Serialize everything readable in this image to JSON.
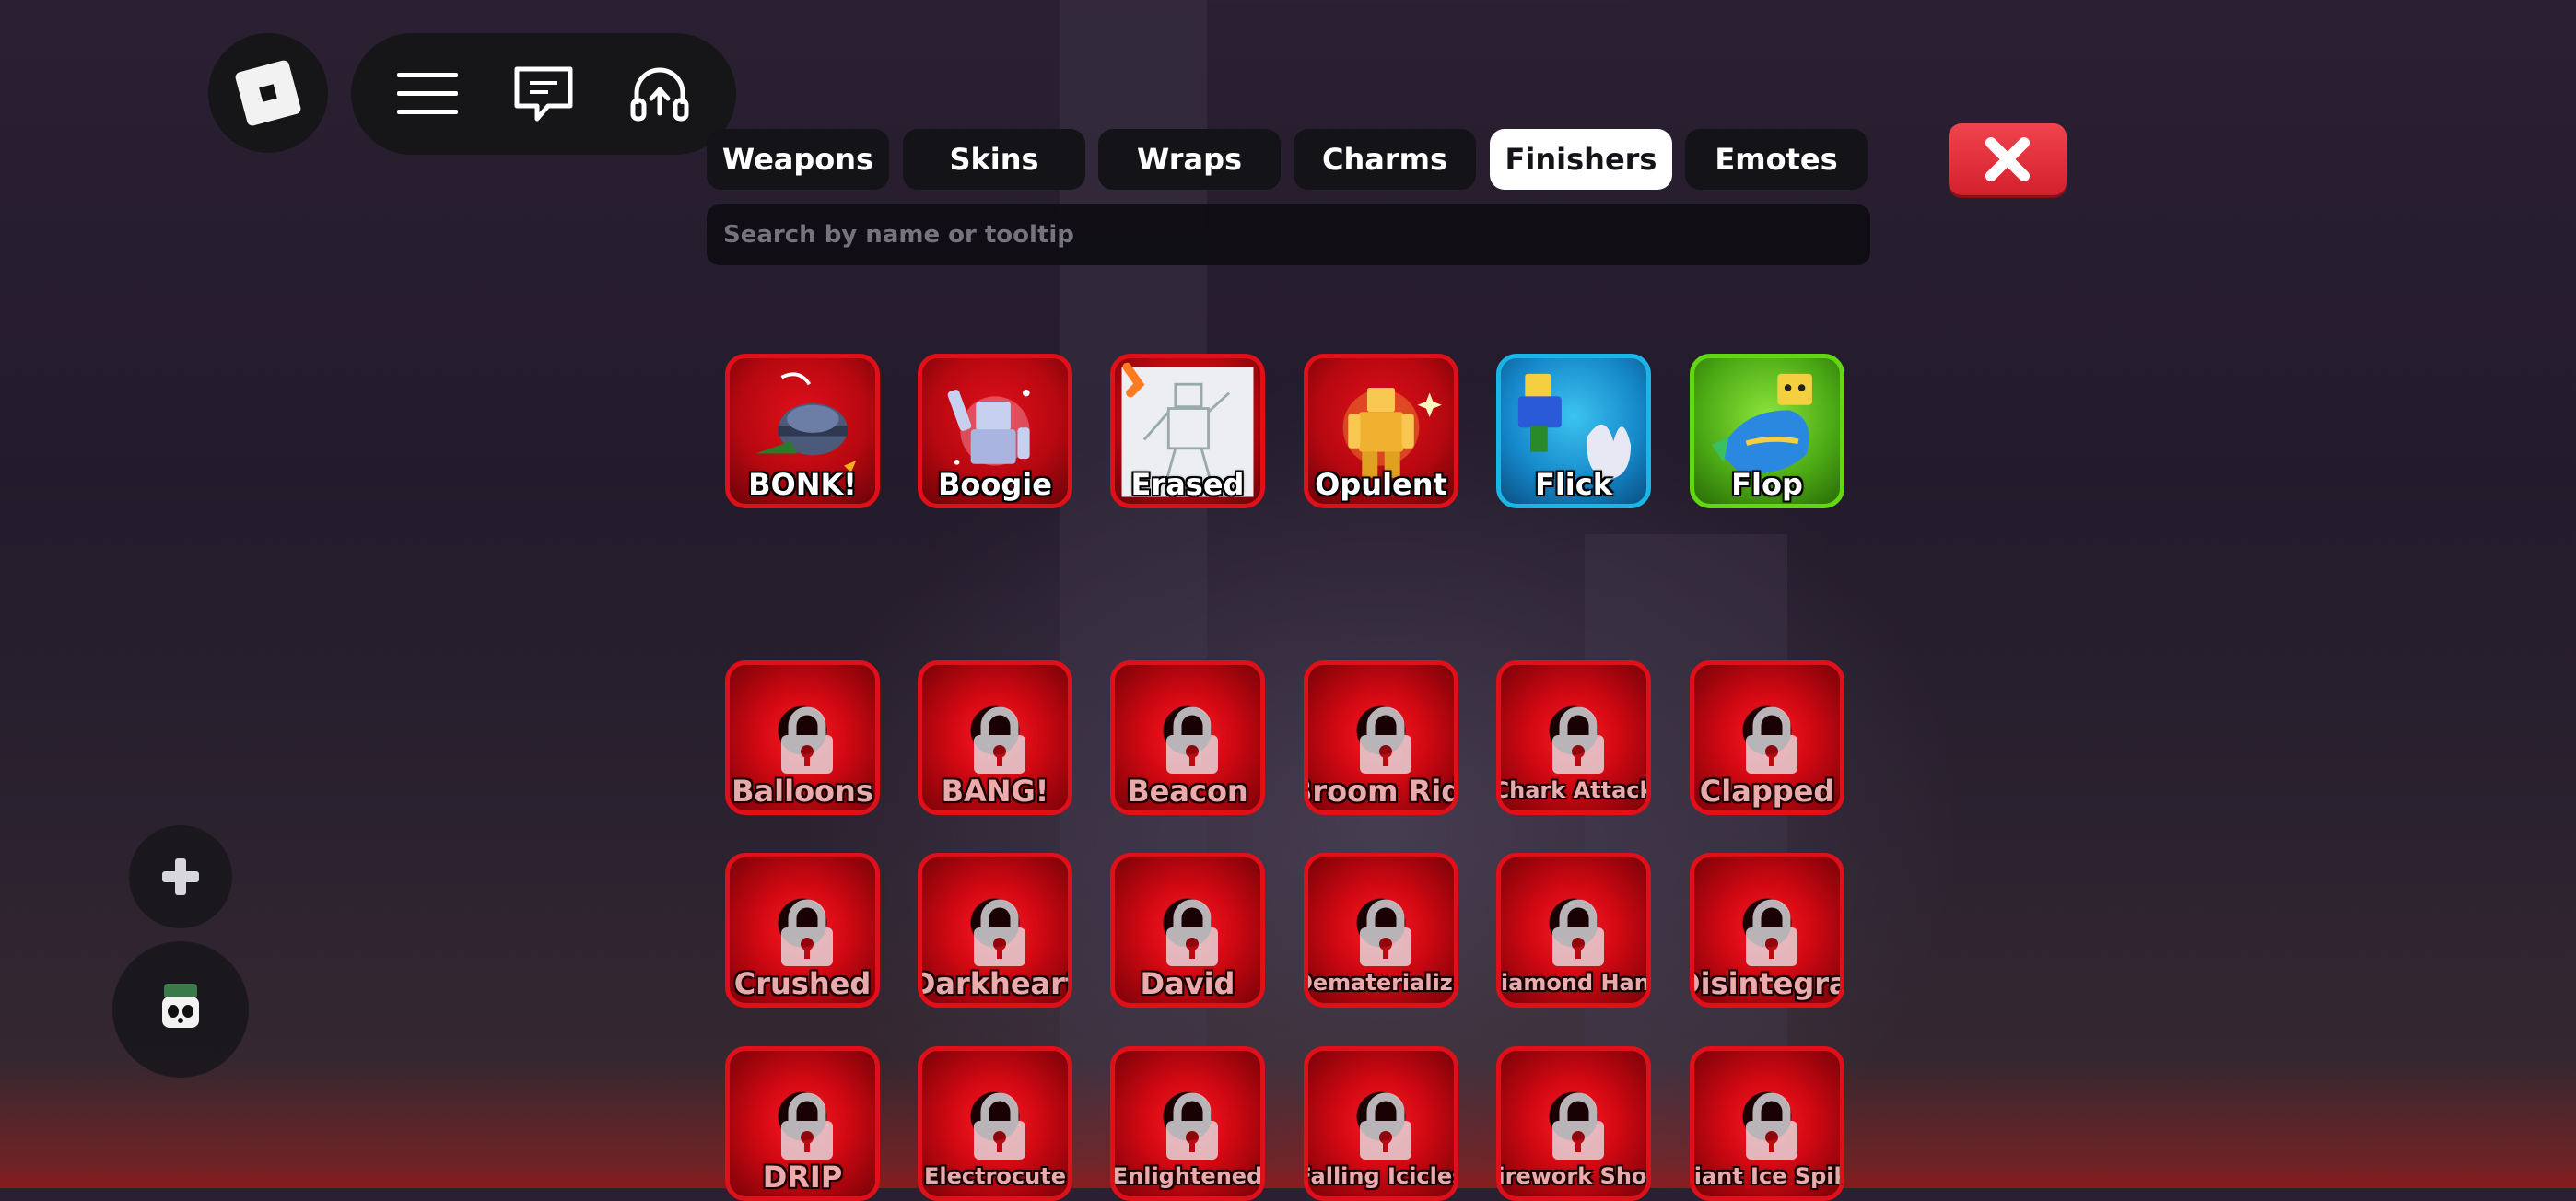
{
  "tabs": [
    {
      "label": "Weapons",
      "active": false
    },
    {
      "label": "Skins",
      "active": false
    },
    {
      "label": "Wraps",
      "active": false
    },
    {
      "label": "Charms",
      "active": false
    },
    {
      "label": "Finishers",
      "active": true
    },
    {
      "label": "Emotes",
      "active": false
    }
  ],
  "search": {
    "placeholder": "Search by name or tooltip",
    "value": ""
  },
  "owned": [
    {
      "label": "BONK!",
      "rarity_color": "#e0101a",
      "icon": "helmet-hammer-art"
    },
    {
      "label": "Boogie",
      "rarity_color": "#e0101a",
      "icon": "dancing-robot-art"
    },
    {
      "label": "Erased",
      "rarity_color": "#e0101a",
      "icon": "sketch-paper-art"
    },
    {
      "label": "Opulent",
      "rarity_color": "#e0101a",
      "icon": "golden-figure-art"
    },
    {
      "label": "Flick",
      "rarity_color": "#1ab6e8",
      "icon": "flick-figure-art"
    },
    {
      "label": "Flop",
      "rarity_color": "#62d812",
      "icon": "fish-figure-art"
    }
  ],
  "locked": [
    [
      "Balloons",
      "BANG!",
      "Beacon",
      "Broom Ride",
      "Chark Attack",
      "Clapped"
    ],
    [
      "Crushed",
      "Darkheart",
      "David",
      "Dematerialize",
      "Diamond Hands",
      "Disintegrate"
    ],
    [
      "DRIP",
      "Electrocute",
      "Enlightened",
      "Falling Icicles",
      "Firework Show",
      "Giant Ice Spike"
    ]
  ],
  "colors": {
    "accent_red": "#e0101a",
    "close_red": "#e22a35",
    "tab_bg": "#141318"
  }
}
